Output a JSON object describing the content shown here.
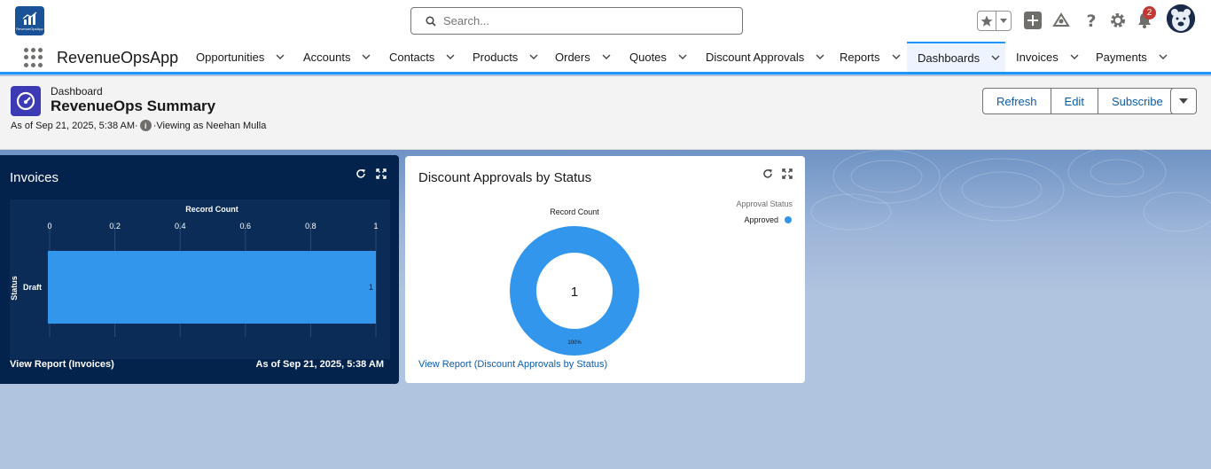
{
  "app": {
    "name": "RevenueOpsApp",
    "logo_text": "RevenueOpsApp"
  },
  "search": {
    "placeholder": "Search..."
  },
  "header": {
    "notification_count": "2"
  },
  "nav": {
    "items": [
      {
        "label": "Opportunities"
      },
      {
        "label": "Accounts"
      },
      {
        "label": "Contacts"
      },
      {
        "label": "Products"
      },
      {
        "label": "Orders"
      },
      {
        "label": "Quotes"
      },
      {
        "label": "Discount Approvals"
      },
      {
        "label": "Reports"
      },
      {
        "label": "Dashboards",
        "active": true
      },
      {
        "label": "Invoices"
      },
      {
        "label": "Payments"
      }
    ]
  },
  "page": {
    "object_label": "Dashboard",
    "title": "RevenueOps Summary",
    "as_of": "As of Sep 21, 2025, 5:38 AM·",
    "viewing_as": "·Viewing as Neehan Mulla",
    "buttons": {
      "refresh": "Refresh",
      "edit": "Edit",
      "subscribe": "Subscribe"
    }
  },
  "colors": {
    "accent": "#1b96ff",
    "bar": "#3296ed",
    "dark_widget": "#03234d",
    "link": "#0b5cab"
  },
  "widgets": {
    "invoices": {
      "title": "Invoices",
      "footer_link": "View Report (Invoices)",
      "footer_timestamp": "As of Sep 21, 2025, 5:38 AM"
    },
    "discount_approvals": {
      "title": "Discount Approvals by Status",
      "footer_link": "View Report (Discount Approvals by Status)"
    }
  },
  "chart_data": [
    {
      "type": "bar",
      "orientation": "horizontal",
      "title": "Record Count",
      "xlabel": "Record Count",
      "ylabel": "Status",
      "categories": [
        "Draft"
      ],
      "values": [
        1
      ],
      "xlim": [
        0,
        1
      ],
      "ticks": [
        "0",
        "0.2",
        "0.4",
        "0.6",
        "0.8",
        "1"
      ],
      "data_labels": [
        "1"
      ],
      "grid": true
    },
    {
      "type": "pie",
      "donut": true,
      "title": "Record Count",
      "legend_title": "Approval Status",
      "legend_position": "top-right",
      "categories": [
        "Approved"
      ],
      "values": [
        1
      ],
      "center_label": "1",
      "slice_labels": [
        "100%"
      ]
    }
  ]
}
